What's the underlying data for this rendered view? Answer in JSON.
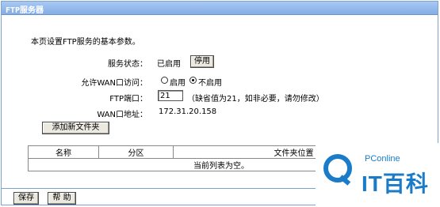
{
  "window": {
    "title": "FTP服务器"
  },
  "intro": "本页设置FTP服务的基本参数。",
  "service_status": {
    "label": "服务状态：",
    "value": "已启用",
    "button": "停用"
  },
  "wan_access": {
    "label": "允许WAN口访问：",
    "option_enable": "启用",
    "option_disable": "不启用",
    "selected": "不启用"
  },
  "ftp_port": {
    "label": "FTP端口：",
    "value": "21",
    "hint": "（缺省值为21，如非必要，请勿修改）"
  },
  "wan_ip": {
    "label": "WAN口地址：",
    "value": "172.31.20.158"
  },
  "add_folder_button": "添加新文件夹",
  "table": {
    "headers": [
      "名称",
      "分区",
      "文件夹位置"
    ],
    "empty_text": "当前列表为空。"
  },
  "footer": {
    "save": "保存",
    "help": "帮 助"
  },
  "watermark": {
    "brand": "PConline",
    "logo_text": "IT百科"
  },
  "colors": {
    "titlebar": "#84aee6",
    "frame": "#7aa3d2",
    "watermark": "#1a7cc9"
  }
}
